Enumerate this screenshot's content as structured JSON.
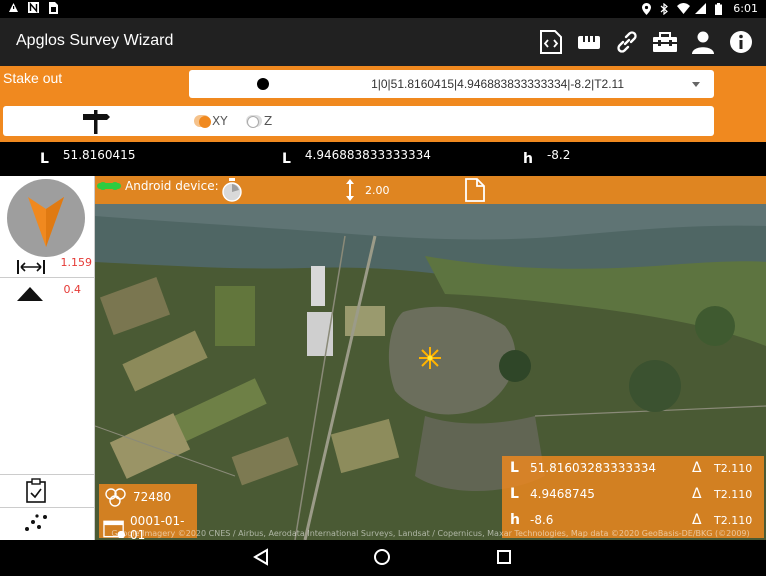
{
  "status_bar": {
    "time": "6:01",
    "left_icons": [
      "warning-icon",
      "n-icon",
      "sim-icon"
    ],
    "right_icons": [
      "location-icon",
      "bluetooth-icon",
      "wifi-icon",
      "signal-icon",
      "battery-icon"
    ]
  },
  "app": {
    "title": "Apglos Survey Wizard",
    "toolbar_icons": [
      "code-file-icon",
      "ruler-icon",
      "link-icon",
      "toolbox-icon",
      "user-icon",
      "info-icon"
    ]
  },
  "stakeout": {
    "label": "Stake out",
    "selected_point": "1|0|51.8160415|4.946883833333334|-8.2|T2.11",
    "modes": [
      {
        "label": "XY",
        "selected": true
      },
      {
        "label": "Z",
        "selected": false
      }
    ]
  },
  "target_coords": {
    "lat_label": "L",
    "lat_value": "51.8160415",
    "lon_label": "L",
    "lon_value": "4.946883833333334",
    "h_label": "h",
    "h_value": "-8.2"
  },
  "left_panel": {
    "distance_value": "1.159",
    "height_value": "0.4"
  },
  "map": {
    "device_label": "Android device:",
    "antenna_height": "2.00",
    "satellites": "72480",
    "date": "0001-01-01",
    "position": {
      "lat_label": "L",
      "lat_value": "51.81603283333334",
      "lat_code": "T2.110",
      "lon_label": "L",
      "lon_value": "4.9468745",
      "lon_code": "T2.110",
      "h_label": "h",
      "h_value": "-8.6",
      "h_code": "T2.110"
    },
    "attribution": "Google  Imagery ©2020 CNES / Airbus, Aerodata International Surveys, Landsat / Copernicus, Maxar Technologies, Map data ©2020 GeoBasis-DE/BKG (©2009)"
  },
  "colors": {
    "accent": "#f0891f",
    "titlebar": "#212121",
    "error_red": "#e53935"
  }
}
